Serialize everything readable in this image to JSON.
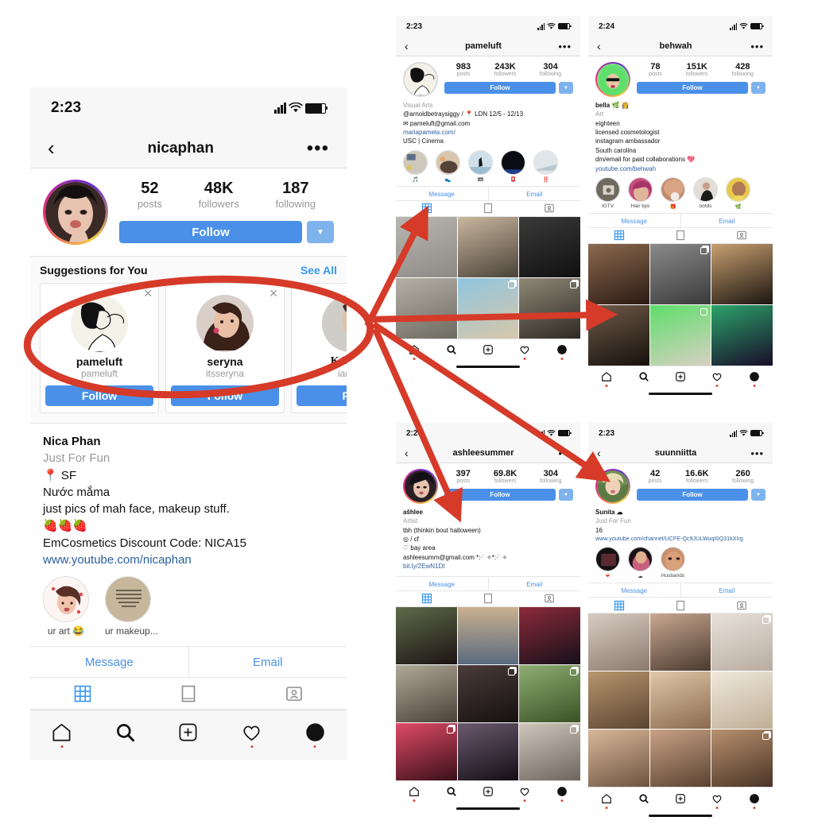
{
  "annotation": {
    "color": "#d63a29",
    "ellipse_label": "highlight-ellipse-suggestions",
    "arrows": 4
  },
  "main_phone": {
    "status": {
      "time": "2:23",
      "signal": "signal-icon",
      "wifi": "wifi-icon",
      "battery": "battery-icon"
    },
    "nav": {
      "back": "‹",
      "title": "nicaphan",
      "more": "•••"
    },
    "stats": [
      {
        "num": "52",
        "label": "posts"
      },
      {
        "num": "48K",
        "label": "followers"
      },
      {
        "num": "187",
        "label": "following"
      }
    ],
    "follow_label": "Follow",
    "suggestions": {
      "title": "Suggestions for You",
      "see_all": "See All",
      "cards": [
        {
          "name": "pameluft",
          "username": "pameluft",
          "follow": "Follow",
          "name_is_image": true
        },
        {
          "name": "seryna",
          "username": "itsseryna",
          "follow": "Follow"
        },
        {
          "name": "KAREN",
          "username": "iamka",
          "follow": "Fol"
        }
      ]
    },
    "bio": {
      "name": "Nica Phan",
      "category": "Just For Fun",
      "lines": [
        "📍 SF",
        "Nước mắma",
        "just pics of mah face, makeup stuff.",
        "🍓🍓🍓",
        "EmCosmetics Discount Code: NICA15"
      ],
      "link": "www.youtube.com/nicaphan"
    },
    "highlights": [
      {
        "label": "ur art 😂"
      },
      {
        "label": "ur makeup..."
      }
    ],
    "message_label": "Message",
    "email_label": "Email",
    "tabs": [
      "grid-tab-icon",
      "reels-tab-icon",
      "tagged-tab-icon"
    ],
    "tabbar": [
      "home-icon",
      "search-icon",
      "add-icon",
      "heart-icon",
      "profile-icon"
    ]
  },
  "phones": [
    {
      "id": "pameluft",
      "status": {
        "time": "2:23"
      },
      "nav": {
        "back": "‹",
        "title": "pameluft",
        "more": "•••"
      },
      "stats": [
        {
          "num": "983",
          "label": "posts"
        },
        {
          "num": "243K",
          "label": "followers"
        },
        {
          "num": "304",
          "label": "following"
        }
      ],
      "follow_label": "Follow",
      "bio": {
        "name": "",
        "category": "Visual Arts",
        "lines": [
          "@arnoldbetraysiggy  / 📍 LDN 12/5 - 12/13",
          "",
          "✉ pameluft@gmail.com",
          "mariapamela.com/",
          "USC | Cinema"
        ],
        "link": ""
      },
      "highlights": [
        {
          "label": "🎵"
        },
        {
          "label": "👟"
        },
        {
          "label": "📼"
        },
        {
          "label": "📮"
        },
        {
          "label": "‼️"
        }
      ],
      "message_label": "Message",
      "email_label": "Email",
      "grid_rows": 2,
      "ring": "plain"
    },
    {
      "id": "behwah",
      "status": {
        "time": "2:24"
      },
      "nav": {
        "back": "‹",
        "title": "behwah",
        "more": "•••"
      },
      "stats": [
        {
          "num": "78",
          "label": "posts"
        },
        {
          "num": "151K",
          "label": "followers"
        },
        {
          "num": "428",
          "label": "following"
        }
      ],
      "follow_label": "Follow",
      "bio": {
        "name": "bella 🌿 👸",
        "category": "Art",
        "lines": [
          "eighteen",
          "licensed cosmetologist",
          "instagram ambassador",
          "South carolina",
          "dm/email for paid collaborations 💖"
        ],
        "link": "youtube.com/behwah"
      },
      "highlights": [
        {
          "label": "IGTV"
        },
        {
          "label": "Hair tips"
        },
        {
          "label": "🎁"
        },
        {
          "label": "ootds"
        },
        {
          "label": "🌿"
        }
      ],
      "message_label": "Message",
      "email_label": "Email",
      "grid_rows": 2,
      "ring": "gradient"
    },
    {
      "id": "ashleesummer",
      "status": {
        "time": "2:24"
      },
      "nav": {
        "back": "‹",
        "title": "ashleesummer",
        "more": "•••"
      },
      "stats": [
        {
          "num": "397",
          "label": "posts"
        },
        {
          "num": "69.8K",
          "label": "followers"
        },
        {
          "num": "304",
          "label": "following"
        }
      ],
      "follow_label": "Follow",
      "bio": {
        "name": "ašhlee",
        "category": "Artist",
        "lines": [
          "tbh (thinkin bout halloween)",
          "◎ / cf",
          "♡ bay area",
          "ashleesumm@gmail.com *:·˙ ✧*:·˙ ✧",
          "bit.ly/2EwN1Dt"
        ],
        "link": ""
      },
      "highlights": [],
      "message_label": "Message",
      "email_label": "Email",
      "grid_rows": 3,
      "ring": "gradient"
    },
    {
      "id": "suunniitta",
      "status": {
        "time": "2:23"
      },
      "nav": {
        "back": "‹",
        "title": "suunniitta",
        "more": "•••"
      },
      "stats": [
        {
          "num": "42",
          "label": "posts"
        },
        {
          "num": "16.6K",
          "label": "followers"
        },
        {
          "num": "260",
          "label": "following"
        }
      ],
      "follow_label": "Follow",
      "bio": {
        "name": "Sunita ☁",
        "category": "Just For Fun",
        "lines": [
          "16"
        ],
        "link": "www.youtube.com/channel/UCFE-Qc9JULWuqI0Q31kXIrg"
      },
      "highlights": [
        {
          "label": "❤"
        },
        {
          "label": "☁"
        },
        {
          "label": "Husbands"
        }
      ],
      "message_label": "Message",
      "email_label": "Email",
      "grid_rows": 3,
      "ring": "gradient"
    }
  ],
  "colors": {
    "instagram_blue": "#4a90e8",
    "link_blue": "#3897f0",
    "annotation_red": "#d63a29",
    "muted_gray": "#999999"
  }
}
